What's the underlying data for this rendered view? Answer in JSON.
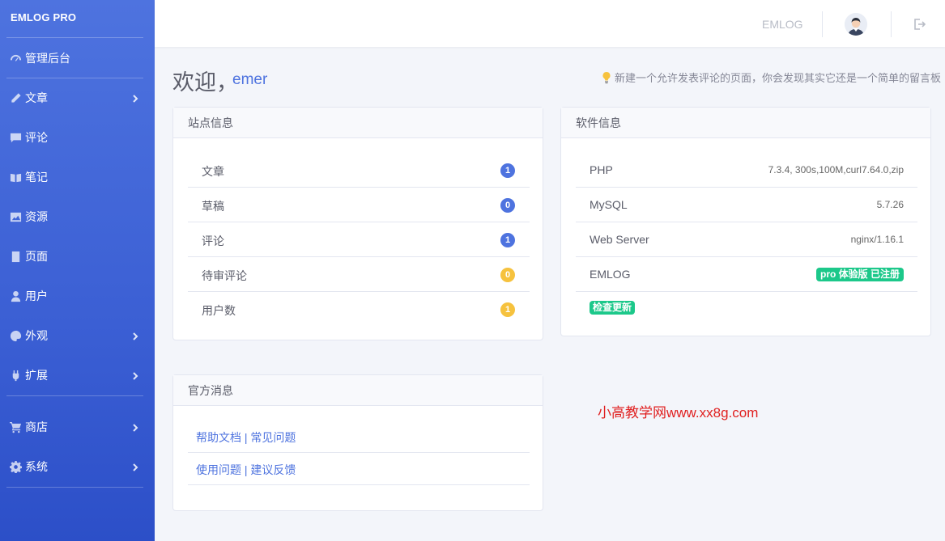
{
  "brand": "EMLOG PRO",
  "sidebar": {
    "items": [
      {
        "label": "管理后台",
        "icon": "dashboard-icon",
        "has_arrow": false
      },
      {
        "label": "文章",
        "icon": "pencil-icon",
        "has_arrow": true
      },
      {
        "label": "评论",
        "icon": "comment-icon",
        "has_arrow": false
      },
      {
        "label": "笔记",
        "icon": "note-icon",
        "has_arrow": false
      },
      {
        "label": "资源",
        "icon": "image-icon",
        "has_arrow": false
      },
      {
        "label": "页面",
        "icon": "page-icon",
        "has_arrow": false
      },
      {
        "label": "用户",
        "icon": "user-icon",
        "has_arrow": false
      },
      {
        "label": "外观",
        "icon": "palette-icon",
        "has_arrow": true
      },
      {
        "label": "扩展",
        "icon": "plug-icon",
        "has_arrow": true
      },
      {
        "label": "商店",
        "icon": "cart-icon",
        "has_arrow": true
      },
      {
        "label": "系统",
        "icon": "gear-icon",
        "has_arrow": true
      }
    ]
  },
  "topbar": {
    "site_link": "EMLOG"
  },
  "welcome": {
    "greeting": "欢迎，",
    "username": "emer",
    "tip": "新建一个允许发表评论的页面，你会发现其实它还是一个简单的留言板"
  },
  "site_info": {
    "title": "站点信息",
    "rows": [
      {
        "label": "文章",
        "count": "1",
        "color": "#4e73df"
      },
      {
        "label": "草稿",
        "count": "0",
        "color": "#4e73df"
      },
      {
        "label": "评论",
        "count": "1",
        "color": "#4e73df"
      },
      {
        "label": "待审评论",
        "count": "0",
        "color": "#f6c23e"
      },
      {
        "label": "用户数",
        "count": "1",
        "color": "#f6c23e"
      }
    ]
  },
  "software_info": {
    "title": "软件信息",
    "rows": [
      {
        "label": "PHP",
        "value": "7.3.4, 300s,100M,curl7.64.0,zip"
      },
      {
        "label": "MySQL",
        "value": "5.7.26"
      },
      {
        "label": "Web Server",
        "value": "nginx/1.16.1"
      }
    ],
    "emlog_label": "EMLOG",
    "emlog_badge": "pro 体验版 已注册",
    "check_update": "检查更新"
  },
  "official_news": {
    "title": "官方消息",
    "links": [
      {
        "a": "帮助文档",
        "sep": " | ",
        "b": "常见问题"
      },
      {
        "a": "使用问题",
        "sep": " | ",
        "b": "建议反馈"
      }
    ]
  },
  "watermark": "小高教学网www.xx8g.com"
}
